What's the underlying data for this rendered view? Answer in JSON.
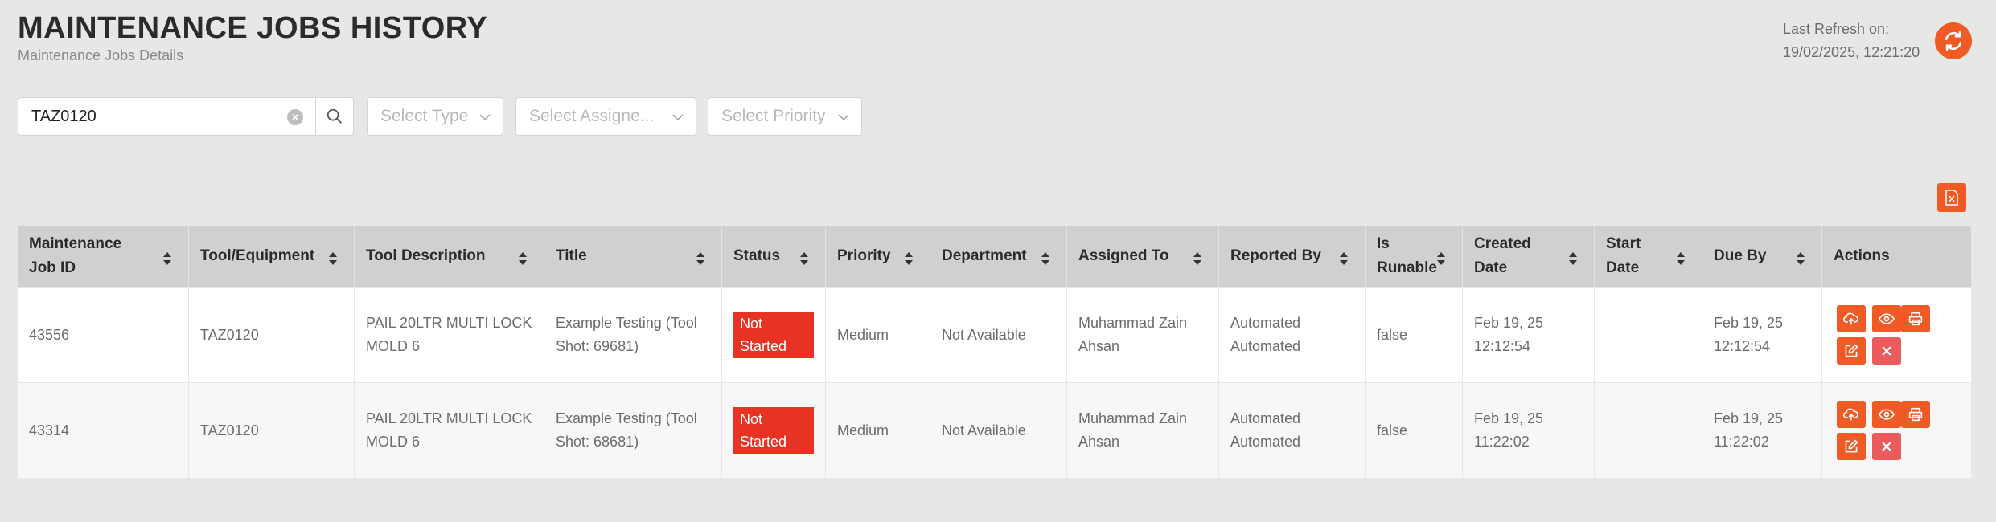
{
  "header": {
    "title": "MAINTENANCE JOBS HISTORY",
    "subtitle": "Maintenance Jobs Details",
    "refresh_label": "Last Refresh on:",
    "refresh_time": "19/02/2025, 12:21:20"
  },
  "filters": {
    "search_value": "TAZ0120",
    "type_placeholder": "Select Type",
    "assignee_placeholder": "Select Assigne...",
    "priority_placeholder": "Select Priority"
  },
  "table": {
    "columns": [
      {
        "line1": "Maintenance",
        "line2": "Job ID"
      },
      {
        "line1": "Tool/Equipment",
        "line2": ""
      },
      {
        "line1": "Tool Description",
        "line2": ""
      },
      {
        "line1": "Title",
        "line2": ""
      },
      {
        "line1": "Status",
        "line2": ""
      },
      {
        "line1": "Priority",
        "line2": ""
      },
      {
        "line1": "Department",
        "line2": ""
      },
      {
        "line1": "Assigned To",
        "line2": ""
      },
      {
        "line1": "Reported By",
        "line2": ""
      },
      {
        "line1": "Is",
        "line2": "Runable"
      },
      {
        "line1": "Created",
        "line2": "Date"
      },
      {
        "line1": "Start",
        "line2": "Date"
      },
      {
        "line1": "Due By",
        "line2": ""
      },
      {
        "line1": "Actions",
        "line2": ""
      }
    ],
    "rows": [
      {
        "job_id": "43556",
        "tool": "TAZ0120",
        "desc1": "PAIL 20LTR MULTI LOCK",
        "desc2": "MOLD 6",
        "title1": "Example Testing (Tool",
        "title2": "Shot: 69681)",
        "status1": "Not",
        "status2": "Started",
        "priority": "Medium",
        "department": "Not Available",
        "assigned1": "Muhammad Zain",
        "assigned2": "Ahsan",
        "reported1": "Automated",
        "reported2": "Automated",
        "runable": "false",
        "created1": "Feb 19, 25",
        "created2": "12:12:54",
        "start": "",
        "due1": "Feb 19, 25",
        "due2": "12:12:54"
      },
      {
        "job_id": "43314",
        "tool": "TAZ0120",
        "desc1": "PAIL 20LTR MULTI LOCK",
        "desc2": "MOLD 6",
        "title1": "Example Testing (Tool",
        "title2": "Shot: 68681)",
        "status1": "Not",
        "status2": "Started",
        "priority": "Medium",
        "department": "Not Available",
        "assigned1": "Muhammad Zain",
        "assigned2": "Ahsan",
        "reported1": "Automated",
        "reported2": "Automated",
        "runable": "false",
        "created1": "Feb 19, 25",
        "created2": "11:22:02",
        "start": "",
        "due1": "Feb 19, 25",
        "due2": "11:22:02"
      }
    ]
  },
  "colors": {
    "accent": "#f05a24",
    "status_not_started": "#e63323",
    "delete": "#ec5b5b",
    "header_bg": "#d0d0d0"
  }
}
